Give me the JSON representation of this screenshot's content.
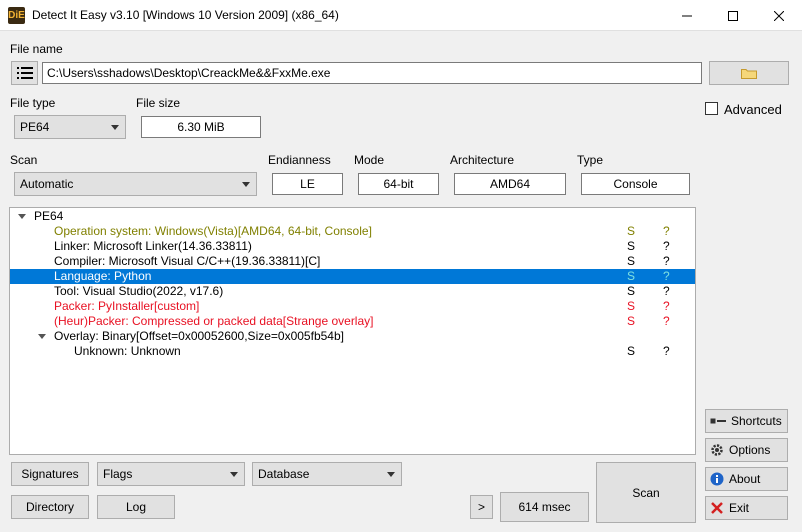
{
  "window": {
    "app_icon_text": "DiE",
    "title": "Detect It Easy v3.10 [Windows 10 Version 2009] (x86_64)"
  },
  "file_name": {
    "label": "File name",
    "value": "C:\\Users\\sshadows\\Desktop\\CreackMe&&FxxMe.exe"
  },
  "file_type": {
    "label": "File type",
    "value": "PE64"
  },
  "file_size": {
    "label": "File size",
    "value": "6.30 MiB"
  },
  "scan": {
    "label": "Scan",
    "value": "Automatic"
  },
  "endianness": {
    "label": "Endianness",
    "value": "LE"
  },
  "mode": {
    "label": "Mode",
    "value": "64-bit"
  },
  "architecture": {
    "label": "Architecture",
    "value": "AMD64"
  },
  "type": {
    "label": "Type",
    "value": "Console"
  },
  "advanced": {
    "label": "Advanced",
    "checked": false
  },
  "results": [
    {
      "text": "PE64",
      "s": "",
      "q": "",
      "color": "normal",
      "indent": 1,
      "expander": true
    },
    {
      "text": "Operation system: Windows(Vista)[AMD64, 64-bit, Console]",
      "s": "S",
      "q": "?",
      "color": "olive",
      "indent": 2
    },
    {
      "text": "Linker: Microsoft Linker(14.36.33811)",
      "s": "S",
      "q": "?",
      "color": "normal",
      "indent": 2
    },
    {
      "text": "Compiler: Microsoft Visual C/C++(19.36.33811)[C]",
      "s": "S",
      "q": "?",
      "color": "normal",
      "indent": 2
    },
    {
      "text": "Language: Python",
      "s": "S",
      "q": "?",
      "color": "selected",
      "indent": 2
    },
    {
      "text": "Tool: Visual Studio(2022, v17.6)",
      "s": "S",
      "q": "?",
      "color": "normal",
      "indent": 2
    },
    {
      "text": "Packer: PyInstaller[custom]",
      "s": "S",
      "q": "?",
      "color": "red",
      "indent": 2
    },
    {
      "text": "(Heur)Packer: Compressed or packed data[Strange overlay]",
      "s": "S",
      "q": "?",
      "color": "red",
      "indent": 2
    },
    {
      "text": "Overlay: Binary[Offset=0x00052600,Size=0x005fb54b]",
      "s": "",
      "q": "",
      "color": "normal",
      "indent": 2,
      "expander": true
    },
    {
      "text": "Unknown: Unknown",
      "s": "S",
      "q": "?",
      "color": "normal",
      "indent": 3
    }
  ],
  "side_buttons": {
    "shortcuts": "Shortcuts",
    "options": "Options",
    "about": "About",
    "exit": "Exit"
  },
  "bottom": {
    "signatures": "Signatures",
    "flags": "Flags",
    "database": "Database",
    "directory": "Directory",
    "log": "Log",
    "more": ">",
    "elapsed": "614 msec",
    "scan": "Scan"
  },
  "colors": {
    "selection": "#0078d7",
    "olive": "#808000",
    "red": "#e81123",
    "teal": "#008080"
  }
}
